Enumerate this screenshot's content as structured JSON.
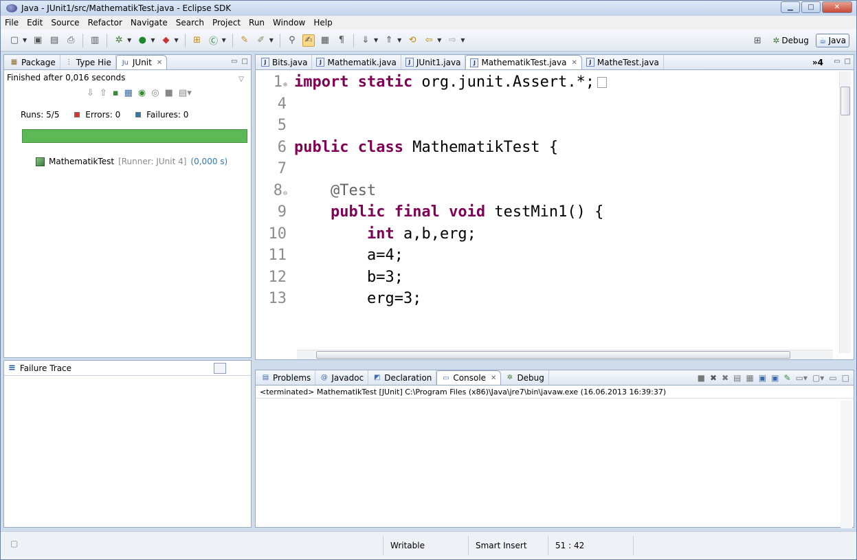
{
  "window": {
    "title": "Java - JUnit1/src/MathematikTest.java - Eclipse SDK"
  },
  "menu": [
    "File",
    "Edit",
    "Source",
    "Refactor",
    "Navigate",
    "Search",
    "Project",
    "Run",
    "Window",
    "Help"
  ],
  "perspectives": {
    "debug": "Debug",
    "java": "Java"
  },
  "left_tabs": [
    {
      "label": "Package",
      "icon": "package-icon"
    },
    {
      "label": "Type Hie",
      "icon": "type-hierarchy-icon"
    },
    {
      "label": "JUnit",
      "icon": "junit-icon",
      "active": true
    }
  ],
  "junit": {
    "status": "Finished after 0,016 seconds",
    "runs_label": "Runs:",
    "runs": "5/5",
    "errors_label": "Errors:",
    "errors": "0",
    "failures_label": "Failures:",
    "failures": "0",
    "progress": 1.0,
    "progress_color": "#5db856",
    "test": {
      "name": "MathematikTest",
      "runner": "[Runner: JUnit 4]",
      "time": "(0,000 s)"
    },
    "trace_title": "Failure Trace"
  },
  "editor_tabs": [
    {
      "label": "Bits.java"
    },
    {
      "label": "Mathematik.java"
    },
    {
      "label": "JUnit1.java"
    },
    {
      "label": "MathematikTest.java",
      "active": true
    },
    {
      "label": "MatheTest.java"
    }
  ],
  "editor_overflow": "»4",
  "code": [
    {
      "n": "1",
      "fold": "⊕",
      "parts": [
        {
          "t": "import static",
          "c": "kw"
        },
        {
          "t": " org.junit.Assert.*;",
          "c": ""
        }
      ]
    },
    {
      "n": "4",
      "fold": "",
      "parts": []
    },
    {
      "n": "5",
      "fold": "",
      "parts": []
    },
    {
      "n": "6",
      "fold": "",
      "parts": [
        {
          "t": "public class",
          "c": "kw"
        },
        {
          "t": " MathematikTest {",
          "c": ""
        }
      ]
    },
    {
      "n": "7",
      "fold": "",
      "parts": []
    },
    {
      "n": "8",
      "fold": "⊖",
      "parts": [
        {
          "t": "    @Test",
          "c": "ann"
        }
      ]
    },
    {
      "n": "9",
      "fold": "",
      "parts": [
        {
          "t": "    ",
          "c": ""
        },
        {
          "t": "public final void",
          "c": "kw"
        },
        {
          "t": " testMin1() {",
          "c": ""
        }
      ]
    },
    {
      "n": "10",
      "fold": "",
      "parts": [
        {
          "t": "        ",
          "c": ""
        },
        {
          "t": "int",
          "c": "kw"
        },
        {
          "t": " a,b,erg;",
          "c": ""
        }
      ]
    },
    {
      "n": "11",
      "fold": "",
      "parts": [
        {
          "t": "        a=4;",
          "c": ""
        }
      ]
    },
    {
      "n": "12",
      "fold": "",
      "parts": [
        {
          "t": "        b=3;",
          "c": ""
        }
      ]
    },
    {
      "n": "13",
      "fold": "",
      "parts": [
        {
          "t": "        erg=3;",
          "c": ""
        }
      ]
    }
  ],
  "bottom_tabs": [
    {
      "label": "Problems",
      "icon": "problems-icon"
    },
    {
      "label": "Javadoc",
      "icon": "javadoc-icon"
    },
    {
      "label": "Declaration",
      "icon": "declaration-icon"
    },
    {
      "label": "Console",
      "icon": "console-icon",
      "active": true
    },
    {
      "label": "Debug",
      "icon": "debug-icon"
    }
  ],
  "console": {
    "text": "<terminated> MathematikTest [JUnit] C:\\Program Files (x86)\\Java\\jre7\\bin\\javaw.exe (16.06.2013 16:39:37)"
  },
  "status": {
    "writable": "Writable",
    "insert_mode": "Smart Insert",
    "position": "51 : 42"
  }
}
